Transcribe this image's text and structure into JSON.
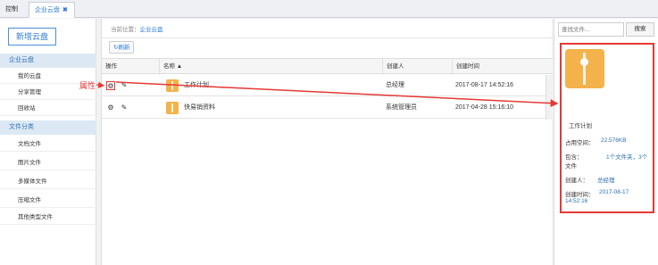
{
  "tabs": [
    {
      "label": "控制台"
    },
    {
      "label": "企业云盘",
      "close": "✖"
    }
  ],
  "sidebar": {
    "new_button": "新增云盘",
    "sections": [
      {
        "label": "企业云盘",
        "items": [
          "我的云盘",
          "分享管理",
          "回收站"
        ]
      },
      {
        "label": "文件分类",
        "items": [
          "文档文件",
          "图片文件",
          "多媒体文件",
          "压缩文件",
          "其他类型文件"
        ]
      }
    ]
  },
  "main": {
    "breadcrumb_prefix": "当前位置：",
    "breadcrumb_current": "企业云盘",
    "refresh_label": "刷新",
    "columns": [
      "操作",
      "名称 ▲",
      "创建人",
      "创建时间"
    ],
    "rows": [
      {
        "name": "工作计划",
        "creator": "总经理",
        "created": "2017-08-17 14:52:16"
      },
      {
        "name": "快易销资料",
        "creator": "系统管理员",
        "created": "2017-04-28 15:16:10"
      }
    ]
  },
  "annotation": {
    "label": "属性"
  },
  "right_panel": {
    "search_placeholder": "查找文件...",
    "search_button": "搜索",
    "folder_name": "工作计划",
    "fields": [
      {
        "label": "占用空间：",
        "value": "22.576KB"
      },
      {
        "label": "包含：",
        "value": "1个文件夹，3个"
      },
      {
        "label": "文件",
        "value": ""
      },
      {
        "label": "创建人：",
        "value": "总经理"
      },
      {
        "label": "创建时间：",
        "value": "2017-08-17"
      },
      {
        "label": "",
        "value": "14:52:16"
      }
    ]
  },
  "colors": {
    "accent": "#2e7bd6",
    "highlight": "#e53935",
    "folder": "#f3b24a"
  }
}
